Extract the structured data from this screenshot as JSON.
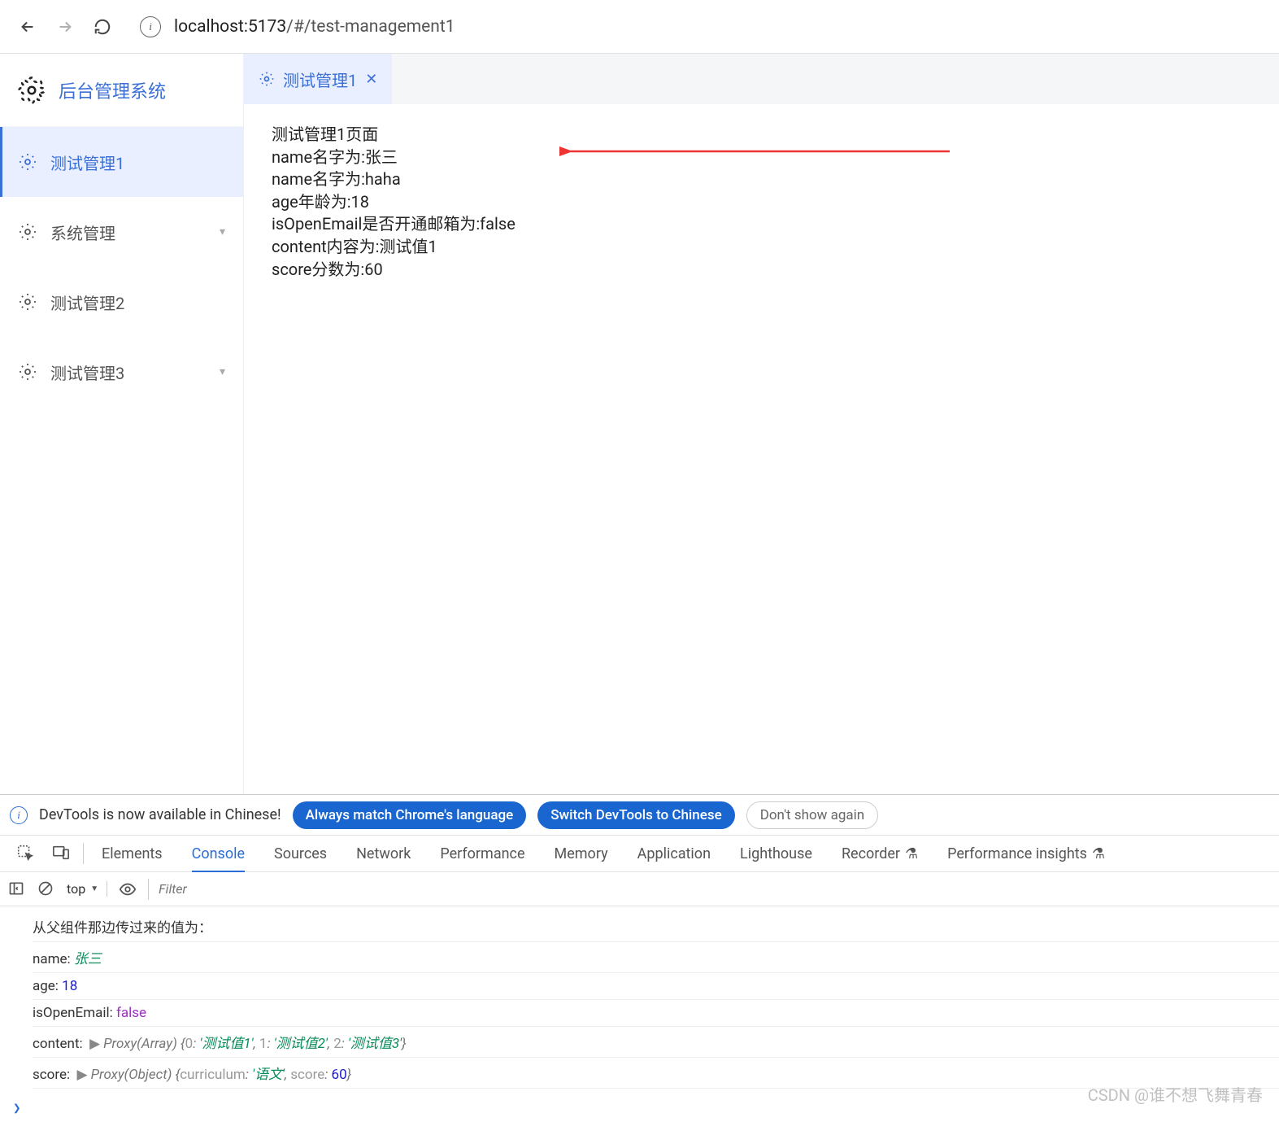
{
  "browser": {
    "url_host": "localhost:",
    "url_port": "5173",
    "url_path": "/#/test-management1"
  },
  "app": {
    "title": "后台管理系统",
    "menu": [
      {
        "label": "测试管理1",
        "active": true,
        "hasChevron": false
      },
      {
        "label": "系统管理",
        "active": false,
        "hasChevron": true
      },
      {
        "label": "测试管理2",
        "active": false,
        "hasChevron": false
      },
      {
        "label": "测试管理3",
        "active": false,
        "hasChevron": true
      }
    ],
    "tab": {
      "label": "测试管理1"
    },
    "content": {
      "line0": "测试管理1页面",
      "line1": "name名字为:张三",
      "line2": "name名字为:haha",
      "line3": "age年龄为:18",
      "line4": "isOpenEmail是否开通邮箱为:false",
      "line5": "content内容为:测试值1",
      "line6": "score分数为:60"
    }
  },
  "devtools": {
    "notice": {
      "text": "DevTools is now available in Chinese!",
      "btn1": "Always match Chrome's language",
      "btn2": "Switch DevTools to Chinese",
      "btn3": "Don't show again"
    },
    "tabs": {
      "t0": "Elements",
      "t1": "Console",
      "t2": "Sources",
      "t3": "Network",
      "t4": "Performance",
      "t5": "Memory",
      "t6": "Application",
      "t7": "Lighthouse",
      "t8": "Recorder",
      "t9": "Performance insights"
    },
    "toolbar": {
      "context": "top",
      "filter_placeholder": "Filter"
    },
    "console": {
      "l0": "从父组件那边传过来的值为：",
      "l1_key": "name:",
      "l1_val": "张三",
      "l2_key": "age:",
      "l2_val": "18",
      "l3_key": "isOpenEmail:",
      "l3_val": "false",
      "l4_key": "content:",
      "l4_type": "Proxy(Array)",
      "l4_obj_open": "{",
      "l4_k0": "0",
      "l4_v0": "'测试值1'",
      "l4_k1": "1",
      "l4_v1": "'测试值2'",
      "l4_k2": "2",
      "l4_v2": "'测试值3'",
      "l4_obj_close": "}",
      "l5_key": "score:",
      "l5_type": "Proxy(Object)",
      "l5_obj_open": "{",
      "l5_k0": "curriculum",
      "l5_v0": "'语文'",
      "l5_k1": "score",
      "l5_v1": "60",
      "l5_obj_close": "}",
      "comma": ", ",
      "colon": ": "
    }
  },
  "watermark": "CSDN @谁不想飞舞青春"
}
